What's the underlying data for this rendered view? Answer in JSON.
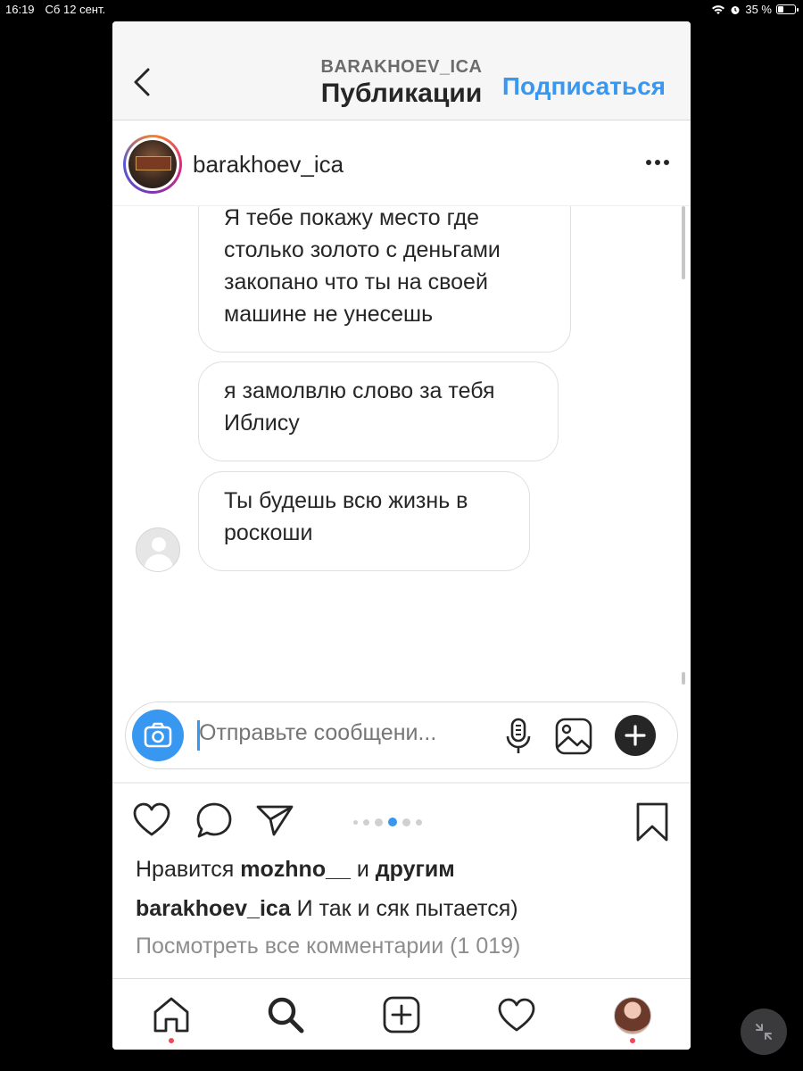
{
  "status_bar": {
    "time": "16:19",
    "date": "Сб 12 сент.",
    "battery": "35 %",
    "battery_level": 0.35
  },
  "header": {
    "account": "BARAKHOEV_ICA",
    "title": "Публикации",
    "follow_label": "Подписаться"
  },
  "post": {
    "username": "barakhoev_ica"
  },
  "dm": {
    "messages": [
      {
        "line1": "Я тебе покажу место где",
        "line2": "столько золото с деньгами",
        "line3": "закопано что ты на своей",
        "line4": "машине не унесешь"
      },
      {
        "line1": "я замолвлю слово за тебя",
        "line2": "Иблису"
      },
      {
        "line1": "Ты будешь всю жизнь в",
        "line2": "роскоши"
      }
    ],
    "composer_placeholder": "Отправьте сообщени..."
  },
  "carousel": {
    "count": 6,
    "active_index": 3
  },
  "likes": {
    "prefix": "Нравится",
    "user": "mozhno__",
    "middle": "и",
    "suffix": "другим"
  },
  "caption": {
    "user": "barakhoev_ica",
    "text": "И так и сяк пытается)"
  },
  "comments_link": "Посмотреть все комментарии (1 019)",
  "colors": {
    "accent": "#3897f0",
    "notification_dot": "#ed4956",
    "text": "#262626",
    "muted": "#8e8e8e"
  },
  "icons": [
    "back-chevron-icon",
    "more-icon",
    "camera-icon",
    "microphone-icon",
    "gallery-icon",
    "plus-icon",
    "heart-icon",
    "comment-icon",
    "share-icon",
    "bookmark-icon",
    "home-icon",
    "search-icon",
    "add-post-icon",
    "activity-icon",
    "profile-avatar",
    "pip-collapse-icon"
  ]
}
